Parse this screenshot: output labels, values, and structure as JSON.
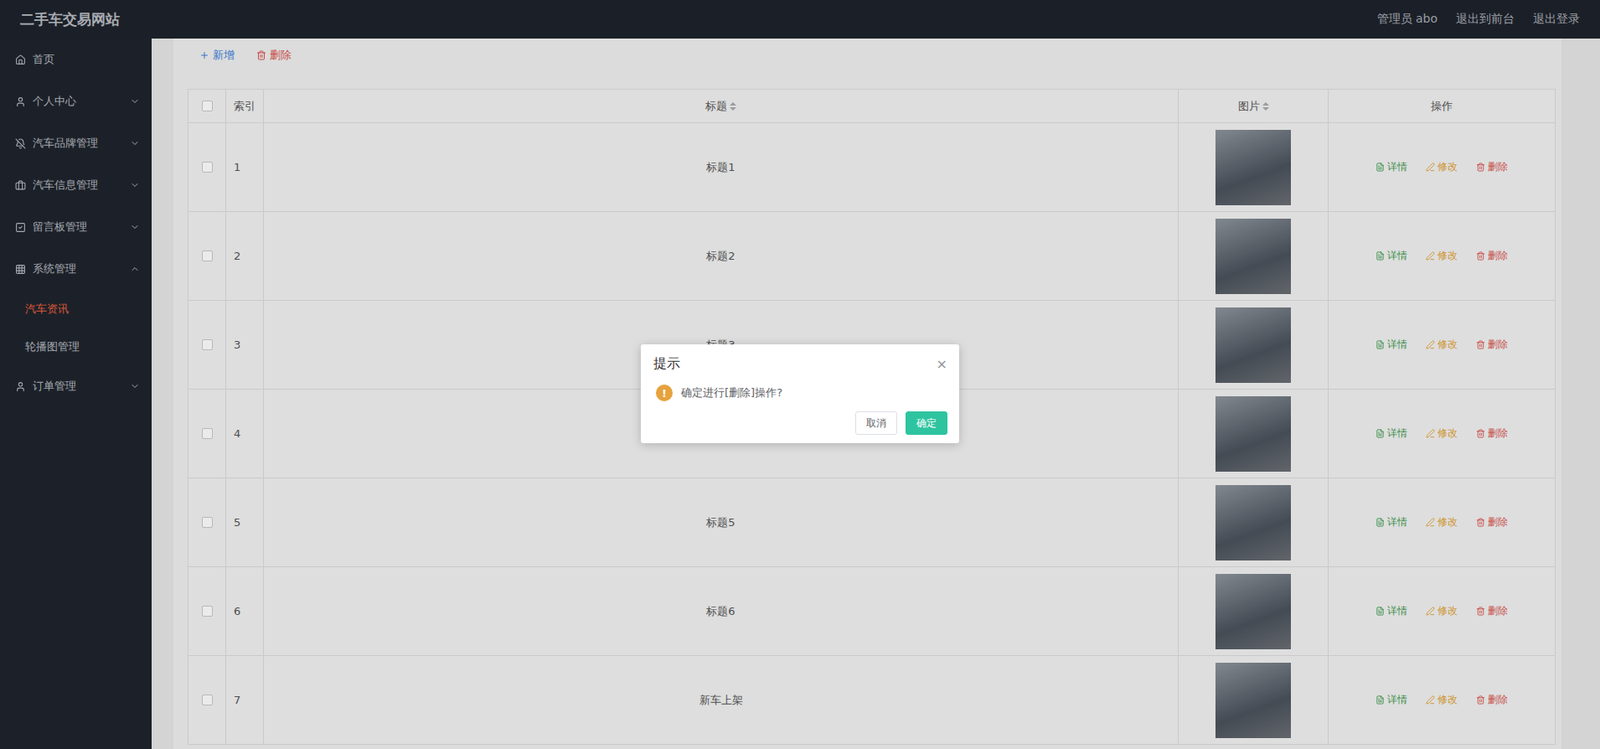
{
  "header": {
    "title": "二手车交易网站",
    "links": [
      "管理员 abo",
      "退出到前台",
      "退出登录"
    ]
  },
  "sidebar": {
    "items": [
      {
        "label": "首页",
        "expandable": false,
        "expanded": false,
        "selected": false,
        "children": []
      },
      {
        "label": "个人中心",
        "expandable": true,
        "expanded": false,
        "selected": false,
        "children": []
      },
      {
        "label": "汽车品牌管理",
        "expandable": true,
        "expanded": false,
        "selected": false,
        "children": []
      },
      {
        "label": "汽车信息管理",
        "expandable": true,
        "expanded": false,
        "selected": false,
        "children": []
      },
      {
        "label": "留言板管理",
        "expandable": true,
        "expanded": false,
        "selected": false,
        "children": []
      },
      {
        "label": "系统管理",
        "expandable": true,
        "expanded": true,
        "selected": false,
        "children": [
          {
            "label": "汽车资讯",
            "selected": true
          },
          {
            "label": "轮播图管理",
            "selected": false
          }
        ]
      },
      {
        "label": "订单管理",
        "expandable": true,
        "expanded": false,
        "selected": false,
        "children": []
      }
    ]
  },
  "toolbar": {
    "buttons": [
      {
        "label": "新增",
        "kind": "add",
        "color": "#3d7fd9"
      },
      {
        "label": "删除",
        "kind": "delete",
        "color": "#d9534f"
      }
    ]
  },
  "table": {
    "header_checked": false,
    "columns": [
      {
        "label": "索引",
        "sortable": false
      },
      {
        "label": "标题",
        "sortable": true
      },
      {
        "label": "图片",
        "sortable": true
      },
      {
        "label": "操作",
        "sortable": false
      }
    ],
    "actions": [
      {
        "label": "详情",
        "kind": "detail",
        "color": "#3f9a50"
      },
      {
        "label": "修改",
        "kind": "edit",
        "color": "#e0a232"
      },
      {
        "label": "删除",
        "kind": "delete",
        "color": "#d9534f"
      }
    ],
    "rows": [
      {
        "index": "1",
        "title": "标题1",
        "checked": false
      },
      {
        "index": "2",
        "title": "标题2",
        "checked": false
      },
      {
        "index": "3",
        "title": "标题3",
        "checked": false
      },
      {
        "index": "4",
        "title": "",
        "checked": false
      },
      {
        "index": "5",
        "title": "标题5",
        "checked": false
      },
      {
        "index": "6",
        "title": "标题6",
        "checked": false
      },
      {
        "index": "7",
        "title": "新车上架",
        "checked": false
      }
    ]
  },
  "dialog": {
    "title": "提示",
    "close": "×",
    "icon": "!",
    "message": "确定进行[删除]操作?",
    "buttons": [
      {
        "label": "取消",
        "primary": false
      },
      {
        "label": "确定",
        "primary": true
      }
    ]
  }
}
